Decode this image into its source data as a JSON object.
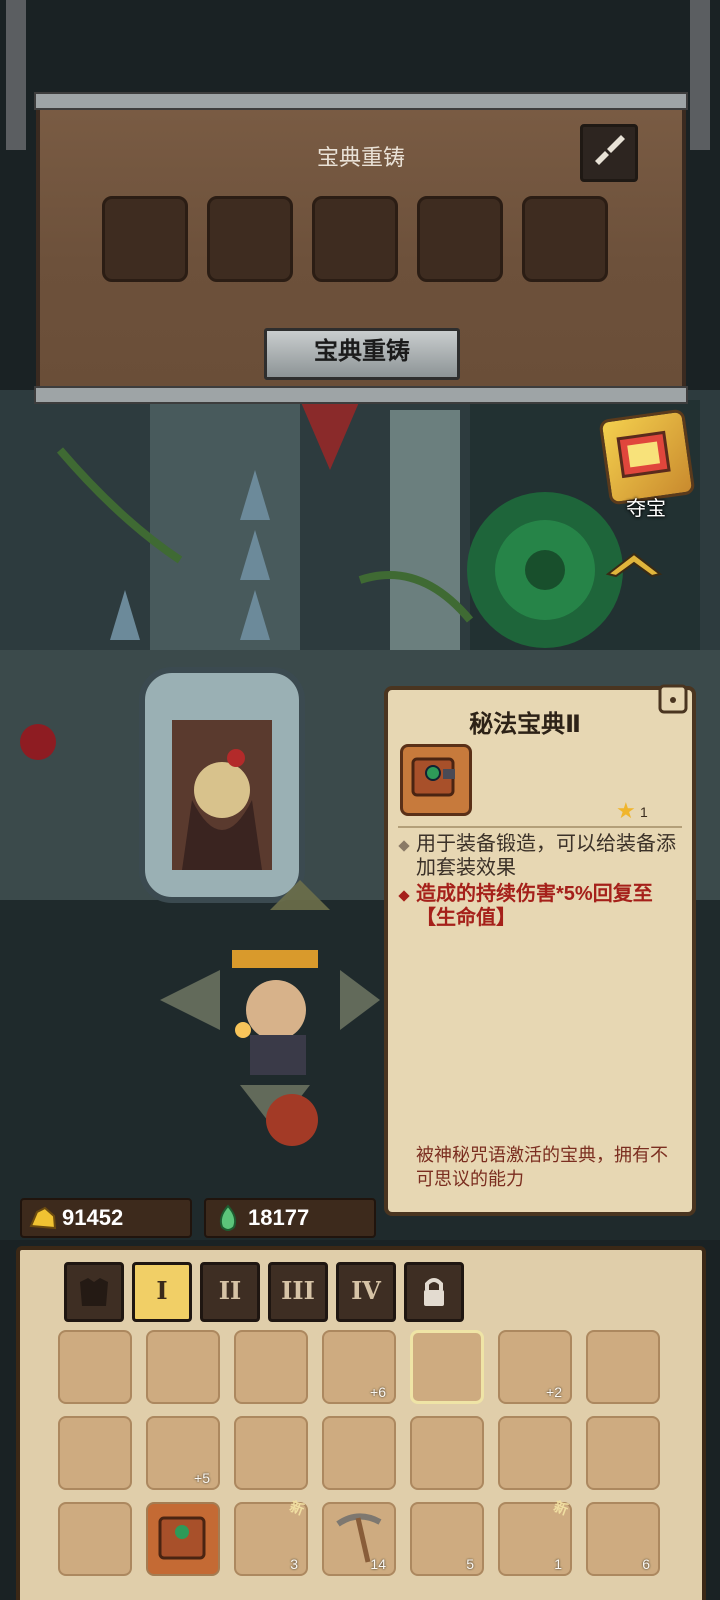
{
  "top_panel": {
    "title": "宝典重铸",
    "button_label": "宝典重铸",
    "slots": [
      "",
      "",
      "",
      "",
      ""
    ]
  },
  "side": {
    "treasure_label": "夺宝"
  },
  "item_card": {
    "title": "秘法宝典Ⅱ",
    "star_count": "1",
    "description": "用于装备锻造，可以给装备添加套装效果",
    "effect": "造成的持续伤害*5%回复至【生命值】",
    "flavor": "被神秘咒语激活的宝典，拥有不可思议的能力"
  },
  "resources": {
    "gold": "91452",
    "essence": "18177"
  },
  "inventory": {
    "tabs": [
      {
        "label": "",
        "icon": "armor-icon"
      },
      {
        "label": "I"
      },
      {
        "label": "II"
      },
      {
        "label": "III"
      },
      {
        "label": "IV"
      },
      {
        "label": "",
        "icon": "lock-icon"
      }
    ],
    "active_tab": 1,
    "rows": [
      [
        {
          "icon": "dark-helmet"
        },
        {
          "icon": "locked-knight-helmet"
        },
        {
          "icon": "horned-mask"
        },
        {
          "icon": "plate-armor",
          "count": "+6"
        },
        {
          "icon": "shadow-cloak"
        },
        {
          "icon": "shadow-cloak",
          "count": "+2"
        },
        {
          "icon": "spiked-gauntlet"
        }
      ],
      [
        {
          "icon": "gem-amulet"
        },
        {
          "icon": "locked-boots",
          "count": "+5"
        },
        {
          "icon": "sun-medallion"
        },
        {
          "icon": "spiked-shield"
        },
        {
          "icon": "fist-glove"
        },
        {
          "icon": "gold-coin"
        },
        {
          "icon": "ring"
        }
      ],
      [
        {
          "icon": "locked-ring"
        },
        {
          "icon": "arcane-tome"
        },
        {
          "icon": "scroll",
          "count": "3",
          "new": "新"
        },
        {
          "icon": "pickaxe",
          "count": "14"
        },
        {
          "icon": "eye-scroll",
          "count": "5"
        },
        {
          "icon": "red-potion",
          "count": "1",
          "new": "新"
        },
        {
          "icon": "blue-potion",
          "count": "6"
        }
      ]
    ]
  },
  "colors": {
    "effect_red": "#a5201a",
    "active_tab": "#f1cf66",
    "panel_wood": "#6d513b"
  }
}
